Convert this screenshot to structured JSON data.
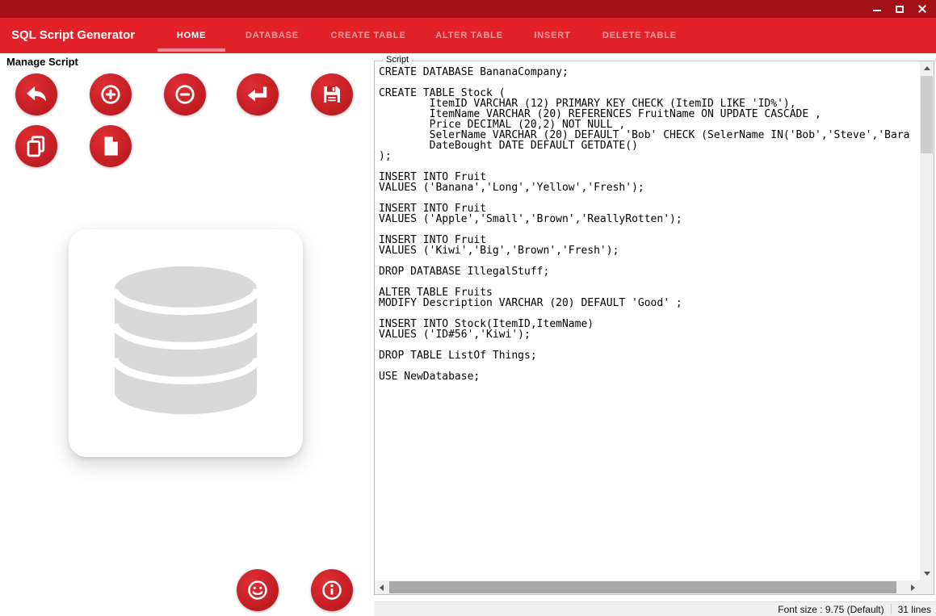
{
  "window": {
    "controls": [
      {
        "name": "minimize"
      },
      {
        "name": "maximize"
      },
      {
        "name": "close"
      }
    ]
  },
  "menubar": {
    "brand": "SQL Script Generator",
    "items": [
      {
        "label": "HOME",
        "active": true
      },
      {
        "label": "DATABASE",
        "active": false
      },
      {
        "label": "CREATE TABLE",
        "active": false
      },
      {
        "label": "ALTER TABLE",
        "active": false
      },
      {
        "label": "INSERT",
        "active": false
      },
      {
        "label": "DELETE TABLE",
        "active": false
      }
    ]
  },
  "left_panel": {
    "heading": "Manage Script",
    "icon_buttons": [
      "undo-icon",
      "add-icon",
      "remove-icon",
      "enter-icon",
      "save-icon",
      "copy-icon",
      "new-file-icon",
      "smiley-icon",
      "info-icon"
    ],
    "artwork": "database-icon"
  },
  "script_box": {
    "label": "Script",
    "code": "CREATE DATABASE BananaCompany;\n\nCREATE TABLE Stock (\n        ItemID VARCHAR (12) PRIMARY KEY CHECK (ItemID LIKE 'ID%'),\n        ItemName VARCHAR (20) REFERENCES FruitName ON UPDATE CASCADE ,\n        Price DECIMAL (20,2) NOT NULL ,\n        SelerName VARCHAR (20) DEFAULT 'Bob' CHECK (SelerName IN('Bob','Steve','Bara\n        DateBought DATE DEFAULT GETDATE()\n);\n\nINSERT INTO Fruit\nVALUES ('Banana','Long','Yellow','Fresh');\n\nINSERT INTO Fruit\nVALUES ('Apple','Small','Brown','ReallyRotten');\n\nINSERT INTO Fruit\nVALUES ('Kiwi','Big','Brown','Fresh');\n\nDROP DATABASE IllegalStuff;\n\nALTER TABLE Fruits\nMODIFY Description VARCHAR (20) DEFAULT 'Good' ;\n\nINSERT INTO Stock(ItemID,ItemName)\nVALUES ('ID#56','Kiwi');\n\nDROP TABLE ListOf Things;\n\nUSE NewDatabase;"
  },
  "statusbar": {
    "font_size": "Font size : 9.75 (Default)",
    "line_count": "31 lines"
  },
  "colors": {
    "titlebar_red": "#a31116",
    "menubar_red": "#e32128",
    "button_red": "#bf1b21",
    "active_tab_underline": "#ee8f93",
    "inactive_menu_text": "#f29a9e",
    "db_icon_gray": "#d8d8d8"
  }
}
